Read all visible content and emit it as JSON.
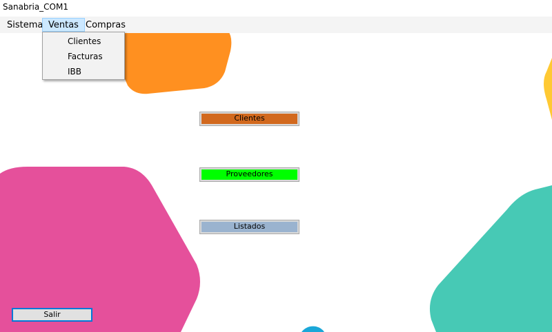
{
  "window": {
    "title": "Sanabria_COM1"
  },
  "menubar": {
    "items": [
      {
        "label": "Sistema"
      },
      {
        "label": "Ventas"
      },
      {
        "label": "Compras"
      }
    ]
  },
  "dropdown": {
    "items": [
      {
        "label": "Clientes"
      },
      {
        "label": "Facturas"
      },
      {
        "label": "IBB"
      }
    ]
  },
  "buttons": {
    "clientes": {
      "label": "Clientes",
      "color": "#d2691e"
    },
    "proveedores": {
      "label": "Proveedores",
      "color": "#00ff00"
    },
    "listados": {
      "label": "Listados",
      "color": "#9ab3cf"
    },
    "salir": {
      "label": "Salir"
    }
  },
  "colors": {
    "orange": "#ff9020",
    "pink": "#e5509b",
    "teal": "#47c9b5",
    "yellow": "#ffc933",
    "blue": "#1aa7d8"
  }
}
